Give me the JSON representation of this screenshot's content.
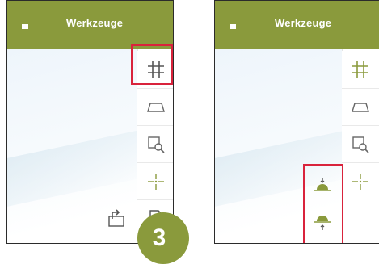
{
  "left_panel": {
    "title": "Werkzeuge",
    "icons": {
      "menu": "menu-icon",
      "grid": "grid-icon",
      "area": "area-measure-icon",
      "zoom_rect": "zoom-rectangle-icon",
      "crosshair": "crosshair-icon",
      "export": "export-icon",
      "pdf": "pdf-icon"
    }
  },
  "right_panel": {
    "title": "Werkzeuge",
    "icons": {
      "menu": "menu-icon",
      "grid": "grid-icon",
      "area": "area-measure-icon",
      "zoom_rect": "zoom-rectangle-icon",
      "crosshair": "crosshair-icon",
      "sunset": "sunset-icon",
      "sunrise": "sunrise-icon"
    }
  },
  "step_badge": "3",
  "colors": {
    "title_bar": "#8a9a3c",
    "highlight": "#d9233c",
    "icon": "#8a9a3c",
    "icon_dark": "#555555"
  }
}
